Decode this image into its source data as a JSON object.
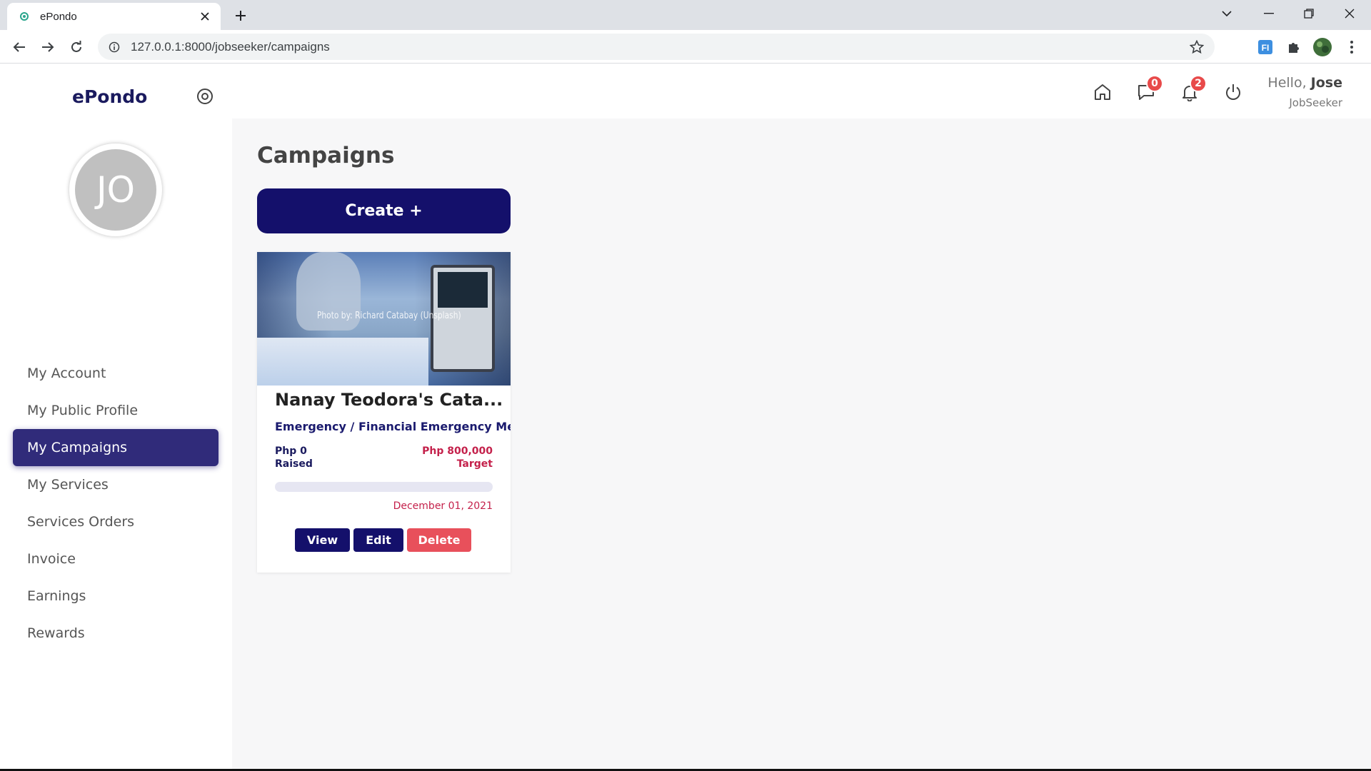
{
  "browser": {
    "tab_title": "ePondo",
    "url": "127.0.0.1:8000/jobseeker/campaigns"
  },
  "sidebar": {
    "brand": "ePondo",
    "avatar_initials": "JO",
    "items": [
      {
        "label": "My Account"
      },
      {
        "label": "My Public Profile"
      },
      {
        "label": "My Campaigns"
      },
      {
        "label": "My Services"
      },
      {
        "label": "Services Orders"
      },
      {
        "label": "Invoice"
      },
      {
        "label": "Earnings"
      },
      {
        "label": "Rewards"
      }
    ],
    "active_index": 2
  },
  "header": {
    "messages_count": "0",
    "notifications_count": "2",
    "greeting": "Hello,",
    "user_name": "Jose",
    "role": "JobSeeker"
  },
  "main": {
    "title": "Campaigns",
    "create_label": "Create +",
    "campaigns": [
      {
        "image_credit": "Photo by: Richard Catabay (Unsplash)",
        "title": "Nanay Teodora's Cata...",
        "category": "Emergency / Financial Emergency Med",
        "raised_amount": "Php 0",
        "raised_label": "Raised",
        "target_amount": "Php 800,000",
        "target_label": "Target",
        "progress_fraction": 0,
        "date": "December 01, 2021",
        "view_label": "View",
        "edit_label": "Edit",
        "delete_label": "Delete"
      }
    ]
  },
  "colors": {
    "primary": "#14106b",
    "active_nav": "#302b7a",
    "danger": "#e8505b",
    "target_text": "#c4214b",
    "badge": "#e84a4a"
  }
}
